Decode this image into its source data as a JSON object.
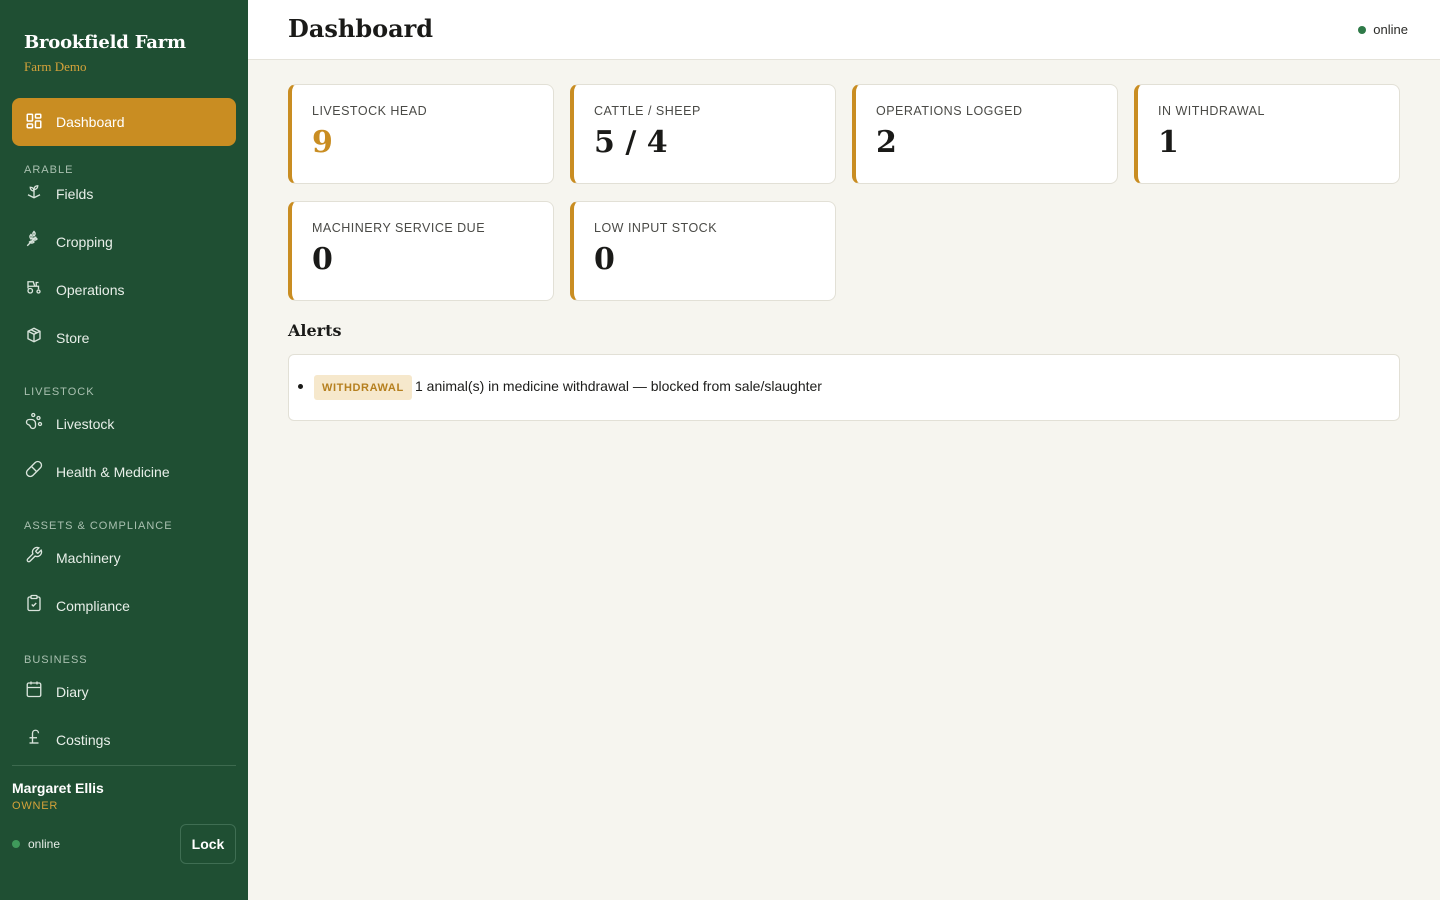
{
  "brand": {
    "title": "Brookfield Farm",
    "subtitle": "Farm Demo"
  },
  "sidebar": {
    "dashboard": "Dashboard",
    "sections": {
      "arable": "ARABLE",
      "livestock": "LIVESTOCK",
      "assets": "ASSETS & COMPLIANCE",
      "business": "BUSINESS"
    },
    "items": {
      "fields": "Fields",
      "cropping": "Cropping",
      "operations": "Operations",
      "store": "Store",
      "livestock": "Livestock",
      "health": "Health & Medicine",
      "machinery": "Machinery",
      "compliance": "Compliance",
      "diary": "Diary",
      "costings": "Costings"
    },
    "user": {
      "name": "Margaret Ellis",
      "role": "OWNER"
    },
    "status": "online",
    "lock_label": "Lock"
  },
  "header": {
    "title": "Dashboard",
    "status": "online"
  },
  "stats": [
    {
      "label": "LIVESTOCK HEAD",
      "value": "9"
    },
    {
      "label": "CATTLE / SHEEP",
      "value": "5 / 4"
    },
    {
      "label": "OPERATIONS LOGGED",
      "value": "2"
    },
    {
      "label": "IN WITHDRAWAL",
      "value": "1"
    },
    {
      "label": "MACHINERY SERVICE DUE",
      "value": "0"
    },
    {
      "label": "LOW INPUT STOCK",
      "value": "0"
    }
  ],
  "alerts": {
    "title": "Alerts",
    "items": [
      {
        "badge": "WITHDRAWAL",
        "text": "1 animal(s) in medicine withdrawal — blocked from sale/slaughter"
      }
    ]
  },
  "colors": {
    "sidebar": "#1f4f33",
    "accent": "#c98d22",
    "background": "#f6f5ef",
    "online": "#2f7a48"
  }
}
